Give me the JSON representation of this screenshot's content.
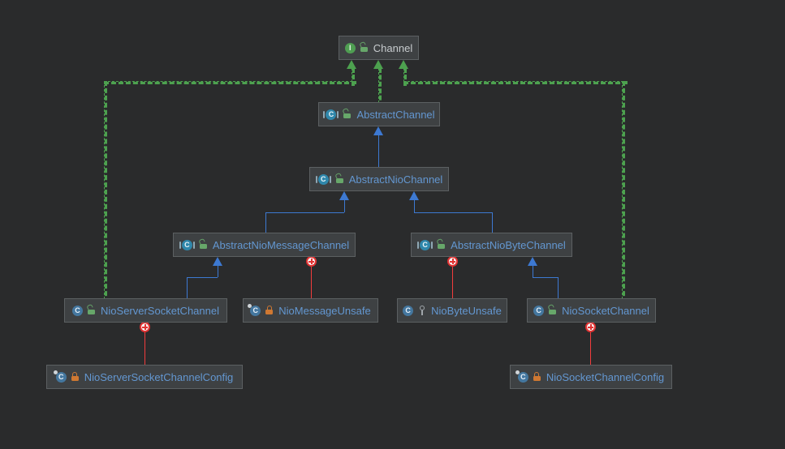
{
  "icons": {
    "interface_letter": "I",
    "class_letter": "C"
  },
  "colors": {
    "background": "#2a2b2c",
    "node_background": "#3e4143",
    "node_border": "#5c6062",
    "class_name_text": "#6397d1",
    "interface_name_text": "#c7cbce",
    "implements_edge": "#4da14f",
    "extends_edge": "#3d79d2",
    "inner_class_edge": "#f23c3c",
    "interface_icon": "#4f9e52",
    "abstract_class_icon": "#2f87ab",
    "class_icon": "#44779f",
    "public_lock": "#67a76a",
    "private_lock": "#cf7832",
    "protected_key": "#a0a6ab"
  },
  "diagram": {
    "nodes": {
      "channel": {
        "label": "Channel",
        "kind": "interface",
        "visibility": "public"
      },
      "abstractChannel": {
        "label": "AbstractChannel",
        "kind": "abstract-class",
        "visibility": "public"
      },
      "abstractNioChannel": {
        "label": "AbstractNioChannel",
        "kind": "abstract-class",
        "visibility": "public"
      },
      "abstractNioMessageChannel": {
        "label": "AbstractNioMessageChannel",
        "kind": "abstract-class",
        "visibility": "public"
      },
      "abstractNioByteChannel": {
        "label": "AbstractNioByteChannel",
        "kind": "abstract-class",
        "visibility": "public"
      },
      "nioServerSocketChannel": {
        "label": "NioServerSocketChannel",
        "kind": "class",
        "visibility": "public"
      },
      "nioMessageUnsafe": {
        "label": "NioMessageUnsafe",
        "kind": "inner-class",
        "visibility": "private"
      },
      "nioByteUnsafe": {
        "label": "NioByteUnsafe",
        "kind": "class",
        "visibility": "protected"
      },
      "nioSocketChannel": {
        "label": "NioSocketChannel",
        "kind": "class",
        "visibility": "public"
      },
      "nioServerSocketChannelConfig": {
        "label": "NioServerSocketChannelConfig",
        "kind": "inner-class",
        "visibility": "private"
      },
      "nioSocketChannelConfig": {
        "label": "NioSocketChannelConfig",
        "kind": "inner-class",
        "visibility": "private"
      }
    },
    "edges": [
      {
        "from": "abstractChannel",
        "to": "channel",
        "type": "implements"
      },
      {
        "from": "nioServerSocketChannel",
        "to": "channel",
        "type": "implements"
      },
      {
        "from": "nioSocketChannel",
        "to": "channel",
        "type": "implements"
      },
      {
        "from": "abstractNioChannel",
        "to": "abstractChannel",
        "type": "extends"
      },
      {
        "from": "abstractNioMessageChannel",
        "to": "abstractNioChannel",
        "type": "extends"
      },
      {
        "from": "abstractNioByteChannel",
        "to": "abstractNioChannel",
        "type": "extends"
      },
      {
        "from": "nioServerSocketChannel",
        "to": "abstractNioMessageChannel",
        "type": "extends"
      },
      {
        "from": "nioSocketChannel",
        "to": "abstractNioByteChannel",
        "type": "extends"
      },
      {
        "from": "abstractNioMessageChannel",
        "to": "nioMessageUnsafe",
        "type": "inner-class"
      },
      {
        "from": "abstractNioByteChannel",
        "to": "nioByteUnsafe",
        "type": "inner-class"
      },
      {
        "from": "nioServerSocketChannel",
        "to": "nioServerSocketChannelConfig",
        "type": "inner-class"
      },
      {
        "from": "nioSocketChannel",
        "to": "nioSocketChannelConfig",
        "type": "inner-class"
      }
    ]
  }
}
